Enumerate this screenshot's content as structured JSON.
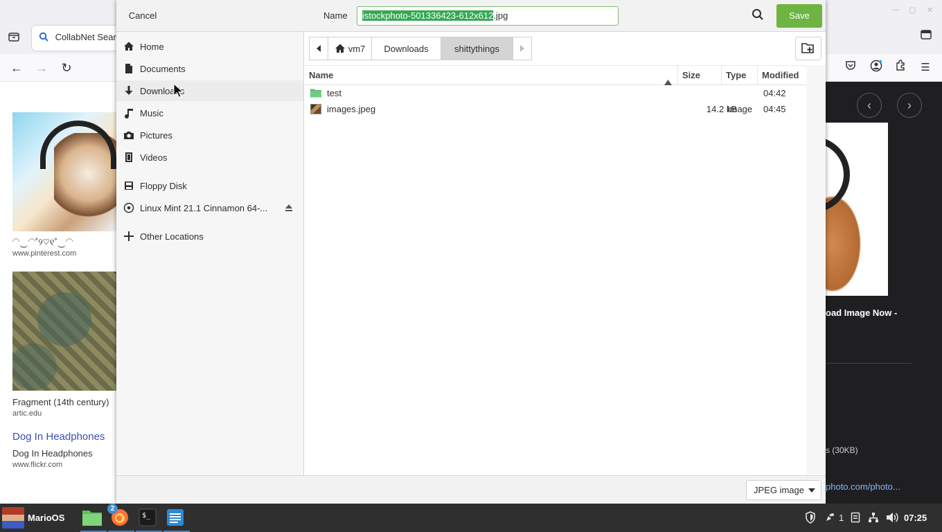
{
  "browser": {
    "tab_title": "CollabNet Sear",
    "results": {
      "caption1": "◠‿◠˚୨♡୧˚‿◠",
      "source1": "www.pinterest.com",
      "caption2": "Fragment (14th century)",
      "source2": "artic.edu",
      "link3": "Dog In Headphones",
      "caption3": "Dog In Headphones",
      "source3": "www.flickr.com"
    },
    "viewer": {
      "title": "oad Image Now -",
      "meta": "s (30KB)",
      "link": "photo.com/photo..."
    }
  },
  "dialog": {
    "cancel_label": "Cancel",
    "name_label": "Name",
    "filename_selected": "istockphoto-501336423-612x612",
    "filename_ext": ".jpg",
    "save_label": "Save",
    "places": [
      {
        "label": "Home",
        "icon": "home-icon"
      },
      {
        "label": "Documents",
        "icon": "document-icon"
      },
      {
        "label": "Downloads",
        "icon": "download-icon"
      },
      {
        "label": "Music",
        "icon": "music-icon"
      },
      {
        "label": "Pictures",
        "icon": "camera-icon"
      },
      {
        "label": "Videos",
        "icon": "video-icon"
      },
      {
        "label": "Floppy Disk",
        "icon": "floppy-icon"
      },
      {
        "label": "Linux Mint 21.1 Cinnamon 64-...",
        "icon": "disc-icon"
      },
      {
        "label": "Other Locations",
        "icon": "plus-icon"
      }
    ],
    "pathbar": [
      "vm7",
      "Downloads",
      "shittythings"
    ],
    "columns": {
      "name": "Name",
      "size": "Size",
      "type": "Type",
      "modified": "Modified"
    },
    "files": [
      {
        "name": "test",
        "size": "",
        "type": "",
        "modified": "04:42",
        "icon": "folder-icon"
      },
      {
        "name": "images.jpeg",
        "size": "14.2 kB",
        "type": "Image",
        "modified": "04:45",
        "icon": "image-thumbnail-icon"
      }
    ],
    "filter_label": "JPEG image"
  },
  "taskbar": {
    "menu_label": "MarioOS",
    "firefox_badge": "2",
    "tray_update_count": "1",
    "clock": "07:25"
  },
  "colors": {
    "accent": "#6db442",
    "selection": "#35a854",
    "folder": "#5fbf72",
    "taskbar": "#2f2f2f"
  }
}
